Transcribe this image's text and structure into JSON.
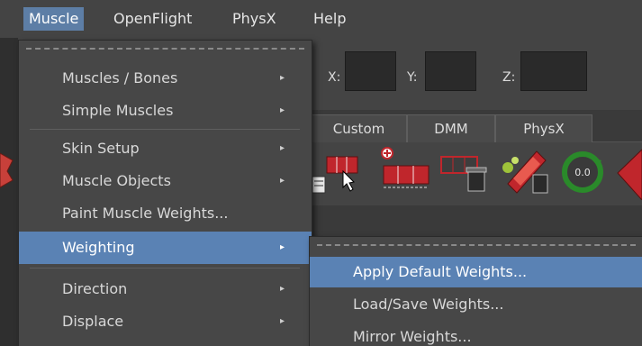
{
  "menubar": {
    "items": [
      "Muscle",
      "OpenFlight",
      "PhysX",
      "Help"
    ]
  },
  "coords": {
    "x_label": "X:",
    "y_label": "Y:",
    "z_label": "Z:"
  },
  "tabs": [
    "Custom",
    "DMM",
    "PhysX"
  ],
  "shelf_value": "0.0",
  "muscle_menu": {
    "items": [
      {
        "label": "Muscles / Bones"
      },
      {
        "label": "Simple Muscles"
      },
      {
        "label": "Skin Setup"
      },
      {
        "label": "Muscle Objects"
      },
      {
        "label": "Paint Muscle Weights..."
      },
      {
        "label": "Weighting"
      },
      {
        "label": "Direction"
      },
      {
        "label": "Displace"
      }
    ],
    "submenu_arrow": "▸"
  },
  "weighting_submenu": {
    "items": [
      {
        "label": "Apply Default Weights..."
      },
      {
        "label": "Load/Save Weights..."
      },
      {
        "label": "Mirror Weights..."
      }
    ]
  },
  "colors": {
    "highlight": "#5a82b4",
    "menubar_active": "#5d7ea6",
    "shelf_red": "#c0262c"
  }
}
